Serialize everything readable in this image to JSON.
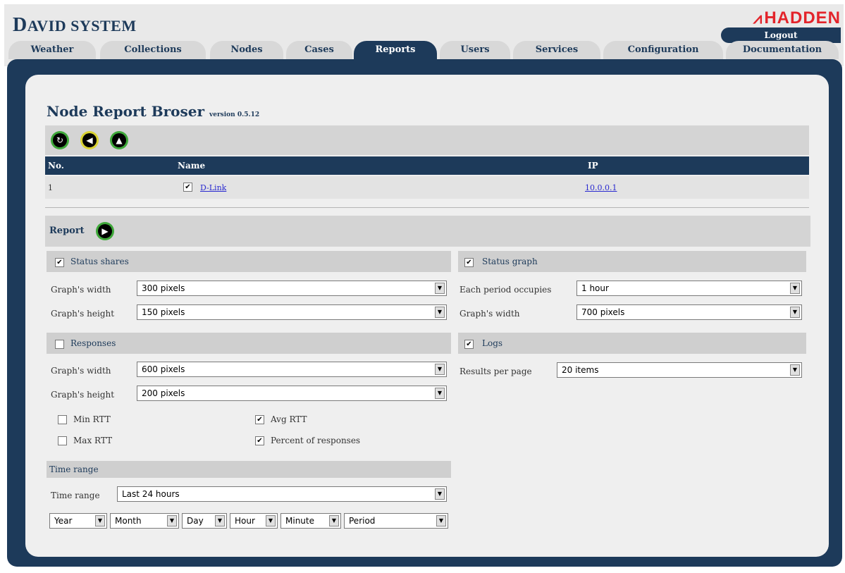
{
  "app": {
    "title_big": "D",
    "title_rest": "AVID SYSTEM",
    "brand": "HADDEN",
    "logout": "Logout"
  },
  "tabs": [
    "Weather",
    "Collections",
    "Nodes",
    "Cases",
    "Reports",
    "Users",
    "Services",
    "Configuration",
    "Documentation"
  ],
  "page": {
    "title": "Node Report Broser",
    "version": "version 0.5.12"
  },
  "table": {
    "headers": {
      "no": "No.",
      "name": "Name",
      "ip": "IP"
    },
    "rows": [
      {
        "no": "1",
        "checked": "✔",
        "name": "D-Link",
        "ip": "10.0.0.1"
      }
    ]
  },
  "report": {
    "label": "Report"
  },
  "status_shares": {
    "title": "Status shares",
    "checked": "✔",
    "width_label": "Graph's width",
    "width_value": "300 pixels",
    "height_label": "Graph's height",
    "height_value": "150 pixels"
  },
  "status_graph": {
    "title": "Status graph",
    "checked": "✔",
    "period_label": "Each period occupies",
    "period_value": "1 hour",
    "width_label": "Graph's width",
    "width_value": "700 pixels"
  },
  "responses": {
    "title": "Responses",
    "checked": "",
    "width_label": "Graph's width",
    "width_value": "600 pixels",
    "height_label": "Graph's height",
    "height_value": "200 pixels",
    "options": [
      {
        "label": "Min RTT",
        "checked": ""
      },
      {
        "label": "Avg RTT",
        "checked": "✔"
      },
      {
        "label": "Max RTT",
        "checked": ""
      },
      {
        "label": "Percent of responses",
        "checked": "✔"
      }
    ]
  },
  "logs": {
    "title": "Logs",
    "checked": "✔",
    "results_label": "Results per page",
    "results_value": "20 items"
  },
  "time_range": {
    "section": "Time range",
    "label": "Time range",
    "value": "Last 24 hours",
    "parts": [
      "Year",
      "Month",
      "Day",
      "Hour",
      "Minute",
      "Period"
    ]
  }
}
